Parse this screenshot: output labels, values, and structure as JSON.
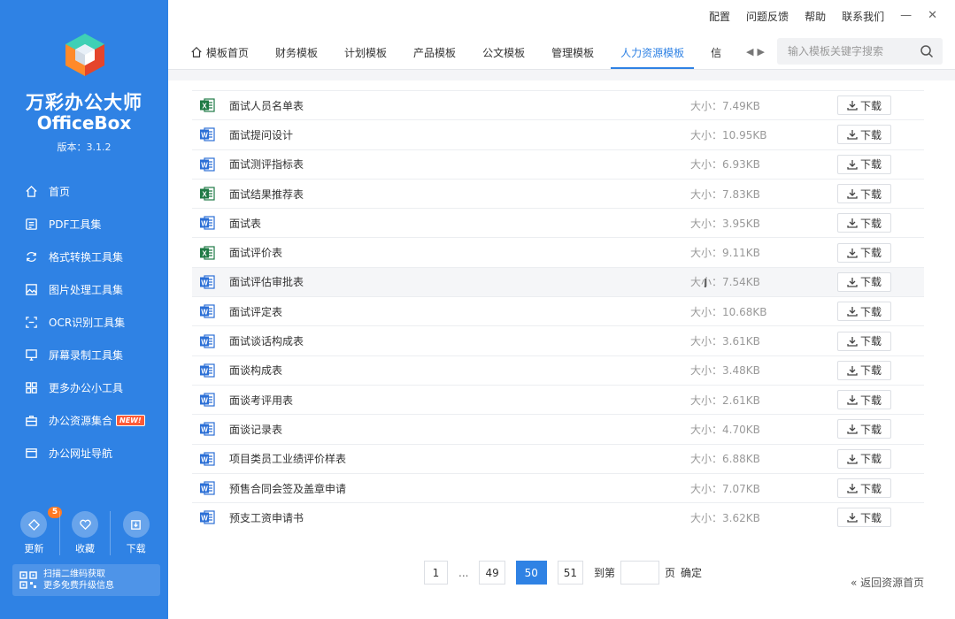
{
  "app": {
    "title": "万彩办公大师",
    "subtitle": "OfficeBox",
    "version": "版本：3.1.2"
  },
  "sidebar": {
    "items": [
      {
        "label": "首页",
        "icon": "home-icon"
      },
      {
        "label": "PDF工具集",
        "icon": "pdf-icon"
      },
      {
        "label": "格式转换工具集",
        "icon": "convert-icon"
      },
      {
        "label": "图片处理工具集",
        "icon": "image-icon"
      },
      {
        "label": "OCR识别工具集",
        "icon": "ocr-icon"
      },
      {
        "label": "屏幕录制工具集",
        "icon": "screen-icon"
      },
      {
        "label": "更多办公小工具",
        "icon": "grid-icon"
      },
      {
        "label": "办公资源集合",
        "icon": "briefcase-icon",
        "badge": "NEW!"
      },
      {
        "label": "办公网址导航",
        "icon": "browser-icon"
      }
    ],
    "quick": [
      {
        "label": "更新",
        "badge": "5",
        "icon": "update-icon"
      },
      {
        "label": "收藏",
        "icon": "heart-icon"
      },
      {
        "label": "下载",
        "icon": "download-icon"
      }
    ],
    "qr": {
      "line1": "扫描二维码获取",
      "line2": "更多免费升级信息"
    }
  },
  "topbar": {
    "links": [
      "配置",
      "问题反馈",
      "帮助",
      "联系我们"
    ],
    "minimize": "—",
    "close": "✕"
  },
  "tabs": [
    "模板首页",
    "财务模板",
    "计划模板",
    "产品模板",
    "公文模板",
    "管理模板",
    "人力资源模板",
    "信"
  ],
  "search": {
    "placeholder": "输入模板关键字搜索"
  },
  "files": [
    {
      "type": "excel",
      "name": "面试人员名单表",
      "size": "大小：7.49KB"
    },
    {
      "type": "word",
      "name": "面试提问设计",
      "size": "大小：10.95KB"
    },
    {
      "type": "word",
      "name": "面试测评指标表",
      "size": "大小：6.93KB"
    },
    {
      "type": "excel",
      "name": "面试结果推荐表",
      "size": "大小：7.83KB"
    },
    {
      "type": "word",
      "name": "面试表",
      "size": "大小：3.95KB"
    },
    {
      "type": "excel",
      "name": "面试评价表",
      "size": "大小：9.11KB"
    },
    {
      "type": "word",
      "name": "面试评估审批表",
      "size": "大小：7.54KB"
    },
    {
      "type": "word",
      "name": "面试评定表",
      "size": "大小：10.68KB"
    },
    {
      "type": "word",
      "name": "面试谈话构成表",
      "size": "大小：3.61KB"
    },
    {
      "type": "word",
      "name": "面谈构成表",
      "size": "大小：3.48KB"
    },
    {
      "type": "word",
      "name": "面谈考评用表",
      "size": "大小：2.61KB"
    },
    {
      "type": "word",
      "name": "面谈记录表",
      "size": "大小：4.70KB"
    },
    {
      "type": "word",
      "name": "项目类员工业绩评价样表",
      "size": "大小：6.88KB"
    },
    {
      "type": "word",
      "name": "预售合同会签及盖章申请",
      "size": "大小：7.07KB"
    },
    {
      "type": "word",
      "name": "预支工资申请书",
      "size": "大小：3.62KB"
    }
  ],
  "download_label": "下载",
  "pager": {
    "first": "1",
    "dots": "...",
    "prev": "49",
    "current": "50",
    "next": "51",
    "goto_label": "到第",
    "page_suffix": "页",
    "confirm": "确定"
  },
  "back_link": "« 返回资源首页",
  "colors": {
    "accent": "#2f82e4",
    "excel": "#1f7a45",
    "word": "#2b6fd6"
  }
}
